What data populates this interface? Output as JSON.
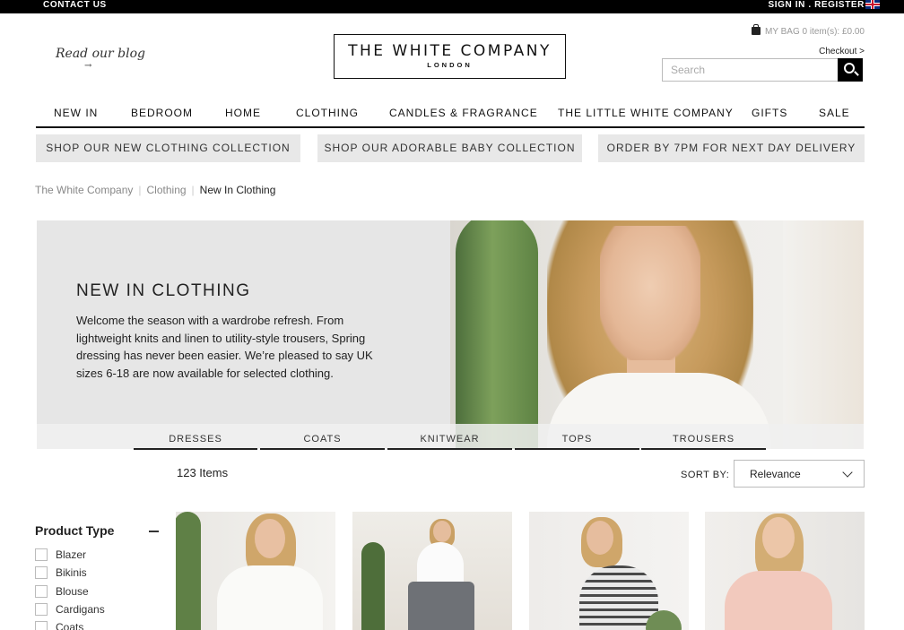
{
  "topbar": {
    "contact": "CONTACT US",
    "signin": "SIGN IN",
    "sep": " . ",
    "register": "REGISTER"
  },
  "header": {
    "blog": "Read our blog",
    "logo_main": "THE WHITE COMPANY",
    "logo_sub": "LONDON",
    "bag": "MY BAG 0 item(s): £0.00",
    "checkout": "Checkout >",
    "search_placeholder": "Search"
  },
  "nav": [
    "NEW IN",
    "BEDROOM",
    "HOME",
    "CLOTHING",
    "CANDLES & FRAGRANCE",
    "THE LITTLE WHITE COMPANY",
    "GIFTS",
    "SALE"
  ],
  "promos": [
    "SHOP OUR NEW CLOTHING COLLECTION",
    "SHOP OUR ADORABLE BABY COLLECTION",
    "ORDER BY 7PM FOR NEXT DAY DELIVERY"
  ],
  "breadcrumb": {
    "home": "The White Company",
    "section": "Clothing",
    "current": "New In Clothing",
    "sep": "|"
  },
  "hero": {
    "title": "NEW IN CLOTHING",
    "description": "Welcome the season with a wardrobe refresh. From lightweight knits and linen to utility-style trousers, Spring dressing has never been easier. We’re pleased to say UK sizes 6-18 are now available for selected clothing."
  },
  "subtabs": [
    "DRESSES",
    "COATS",
    "KNITWEAR",
    "TOPS",
    "TROUSERS"
  ],
  "results": {
    "count": "123 Items",
    "sort_label": "SORT BY:",
    "sort_value": "Relevance"
  },
  "filter": {
    "heading": "Product Type",
    "options": [
      "Blazer",
      "Bikinis",
      "Blouse",
      "Cardigans",
      "Coats"
    ]
  },
  "colors": {
    "accent": "#000000",
    "promo_bg": "#e8e8e8",
    "hero_bg": "#e6e6e6"
  }
}
